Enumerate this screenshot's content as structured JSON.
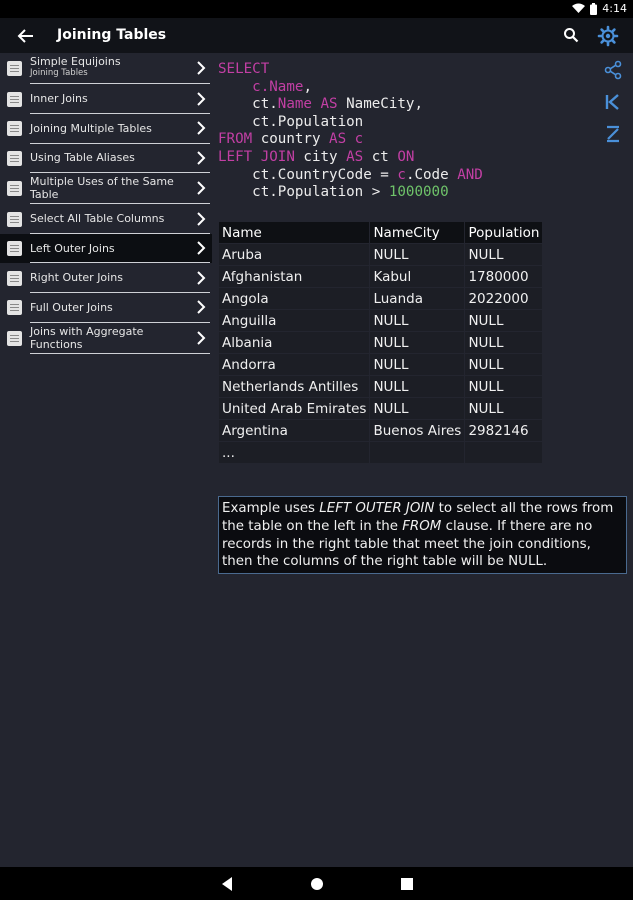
{
  "status_bar": {
    "time": "4:14"
  },
  "app_bar": {
    "title": "Joining Tables"
  },
  "sidebar": {
    "items": [
      {
        "label": "Simple Equijoins",
        "sub": "Joining Tables"
      },
      {
        "label": "Inner Joins",
        "sub": ""
      },
      {
        "label": "Joining Multiple Tables",
        "sub": ""
      },
      {
        "label": "Using Table Aliases",
        "sub": ""
      },
      {
        "label": "Multiple Uses of the Same Table",
        "sub": ""
      },
      {
        "label": "Select All Table Columns",
        "sub": ""
      },
      {
        "label": "Left Outer Joins",
        "sub": "",
        "active": true
      },
      {
        "label": "Right Outer Joins",
        "sub": ""
      },
      {
        "label": "Full Outer Joins",
        "sub": ""
      },
      {
        "label": "Joins with Aggregate Functions",
        "sub": ""
      }
    ]
  },
  "code": {
    "l1_kw": "SELECT",
    "l2_a": "c",
    "l2_b": ".Name",
    "l2_c": ",",
    "l3_a": "ct.",
    "l3_b": "Name AS",
    "l3_c": " NameCity,",
    "l4": "ct.Population",
    "l5_kw": "FROM",
    "l5_a": " country ",
    "l5_kw2": "AS c",
    "l6_kw": "LEFT JOIN",
    "l6_a": " city ",
    "l6_kw2": "AS",
    "l6_b": " ct ",
    "l6_kw3": "ON",
    "l7_a": "ct.CountryCode = ",
    "l7_kw": "c",
    "l7_b": ".Code ",
    "l7_kw2": "AND",
    "l8_a": "ct.Population > ",
    "l8_num": "1000000"
  },
  "table": {
    "headers": [
      "Name",
      "NameCity",
      "Population"
    ],
    "rows": [
      [
        "Aruba",
        "NULL",
        "NULL"
      ],
      [
        "Afghanistan",
        "Kabul",
        "1780000"
      ],
      [
        "Angola",
        "Luanda",
        "2022000"
      ],
      [
        "Anguilla",
        "NULL",
        "NULL"
      ],
      [
        "Albania",
        "NULL",
        "NULL"
      ],
      [
        "Andorra",
        "NULL",
        "NULL"
      ],
      [
        "Netherlands Antilles",
        "NULL",
        "NULL"
      ],
      [
        "United Arab Emirates",
        "NULL",
        "NULL"
      ],
      [
        "Argentina",
        "Buenos Aires",
        "2982146"
      ],
      [
        "...",
        "",
        ""
      ]
    ]
  },
  "note": {
    "p1": "Example uses ",
    "i1": "LEFT OUTER JOIN",
    "p2": " to select all the rows from the table on the left in the ",
    "i2": "FROM",
    "p3": " clause. If there are no records in the right table that meet the join conditions, then the columns of the right table will be NULL."
  },
  "colors": {
    "background": "#23252f",
    "keyword": "#c23fa4",
    "number": "#6fc46a",
    "accent_icon": "#4a90d9",
    "note_border": "#4a6a8f"
  },
  "icons": {
    "back": "arrow-left-icon",
    "search": "search-icon",
    "settings": "gear-icon",
    "share": "share-icon",
    "first": "skip-first-icon",
    "sort": "sort-z-icon",
    "item": "document-icon",
    "chevron": "chevron-right-icon"
  }
}
